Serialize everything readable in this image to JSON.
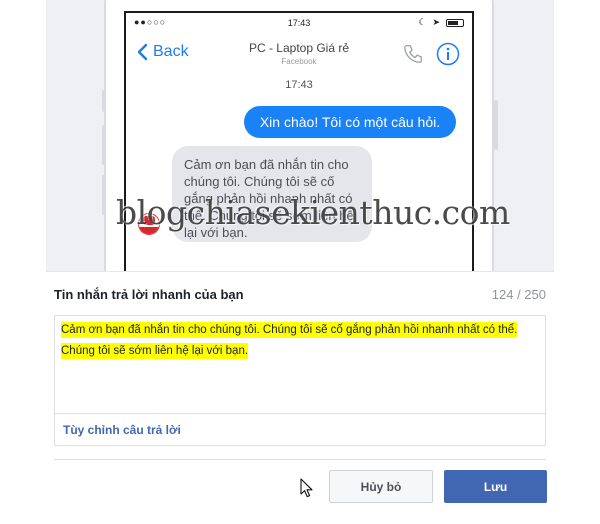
{
  "phone": {
    "status_time": "17:43",
    "back_label": "Back",
    "page_name": "PC - Laptop Giá rẻ",
    "page_subtitle": "Facebook",
    "message_time": "17:43",
    "outgoing_message": "Xin chào! Tôi có một câu hỏi.",
    "incoming_message": "Cảm ơn bạn đã nhắn tin cho chúng tôi. Chúng tôi sẽ cố gắng phản hồi nhanh nhất có thể. Chúng tôi sẽ sớm liên hệ lại với bạn.",
    "accent_color": "#1a82f7"
  },
  "watermark": "blogchiasekienthuc.com",
  "panel": {
    "title": "Tin nhắn trả lời nhanh của bạn",
    "char_count": "124 / 250",
    "reply_text": "Cảm ơn bạn đã nhắn tin cho chúng tôi. Chúng tôi sẽ cố gắng phản hồi nhanh nhất có thể. Chúng tôi sẽ sớm liên hệ lại với bạn.",
    "highlight_color": "#ffff00",
    "customize_label": "Tùy chỉnh câu trả lời"
  },
  "buttons": {
    "cancel_label": "Hủy bỏ",
    "save_label": "Lưu",
    "primary_color": "#4267b2"
  }
}
